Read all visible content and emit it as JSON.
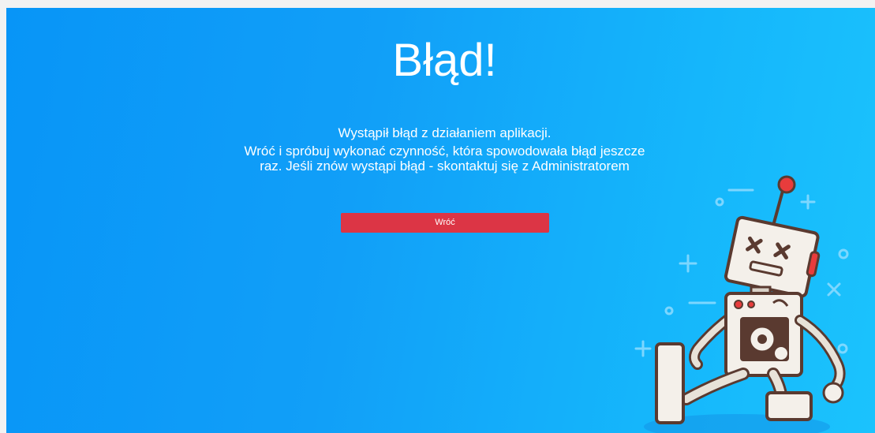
{
  "error": {
    "title": "Błąd!",
    "message_line1": "Wystąpił błąd z działaniem aplikacji.",
    "message_line2": "Wróć i spróbuj wykonać czynność, która spowodowała błąd jeszcze raz. Jeśli znów wystąpi błąd - skontaktuj się z Administratorem",
    "back_button_label": "Wróć"
  },
  "illustration": {
    "icon": "broken-robot-icon"
  },
  "colors": {
    "background_start": "#0895f7",
    "background_end": "#1bc3fd",
    "button": "#dc3545",
    "text": "#ffffff"
  }
}
